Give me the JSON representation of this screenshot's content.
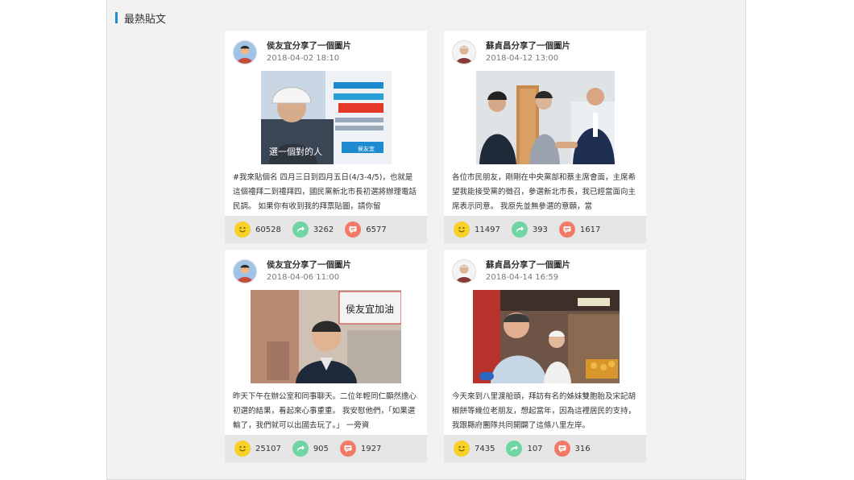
{
  "section": {
    "title": "最熱貼文",
    "accent": "#1a8fd6"
  },
  "icons": {
    "like": "smiley-icon",
    "share": "share-arrow-icon",
    "comment": "comment-bubble-icon"
  },
  "colors": {
    "like": "#f6d128",
    "share": "#6fd6a3",
    "comment": "#f07a66"
  },
  "posts": [
    {
      "author_line": "侯友宜分享了一個圖片",
      "date": "2018-04-02 18:10",
      "text": "#我來貼個名 四月三日到四月五日(4/3-4/5)，也就是這個禮拜二到禮拜四，國民黨新北市長初選將辦理電話民調。 如果你有收到我的拜票貼圖，請你留",
      "likes": "60528",
      "shares": "3262",
      "comments": "6577",
      "photo_caption": "選一個對的人",
      "photo_side": "侯友宜"
    },
    {
      "author_line": "蘇貞昌分享了一個圖片",
      "date": "2018-04-12 13:00",
      "text": "各位市民朋友，剛剛在中央黨部和蔡主席會面，主席希望我能接受黨的徵召，參選新北市長，我已經當面向主席表示同意。 我原先並無參選的意願，當",
      "likes": "11497",
      "shares": "393",
      "comments": "1617"
    },
    {
      "author_line": "侯友宜分享了一個圖片",
      "date": "2018-04-06 11:00",
      "text": "昨天下午在辦公室和同事聊天。二位年輕同仁顯然擔心初選的結果，看起來心事重重。 我安慰他們，「如果選輸了，我們就可以出國去玩了。」 一旁資",
      "likes": "25107",
      "shares": "905",
      "comments": "1927",
      "photo_sign": "侯友宜加油"
    },
    {
      "author_line": "蘇貞昌分享了一個圖片",
      "date": "2018-04-14 16:59",
      "text": "今天來到八里渡船頭，拜訪有名的姊妹雙胞胎及宋記胡椒餅等幾位老朋友，想起當年，因為這裡居民的支持，我跟縣府團隊共同開闢了這條八里左岸。",
      "likes": "7435",
      "shares": "107",
      "comments": "316"
    }
  ]
}
